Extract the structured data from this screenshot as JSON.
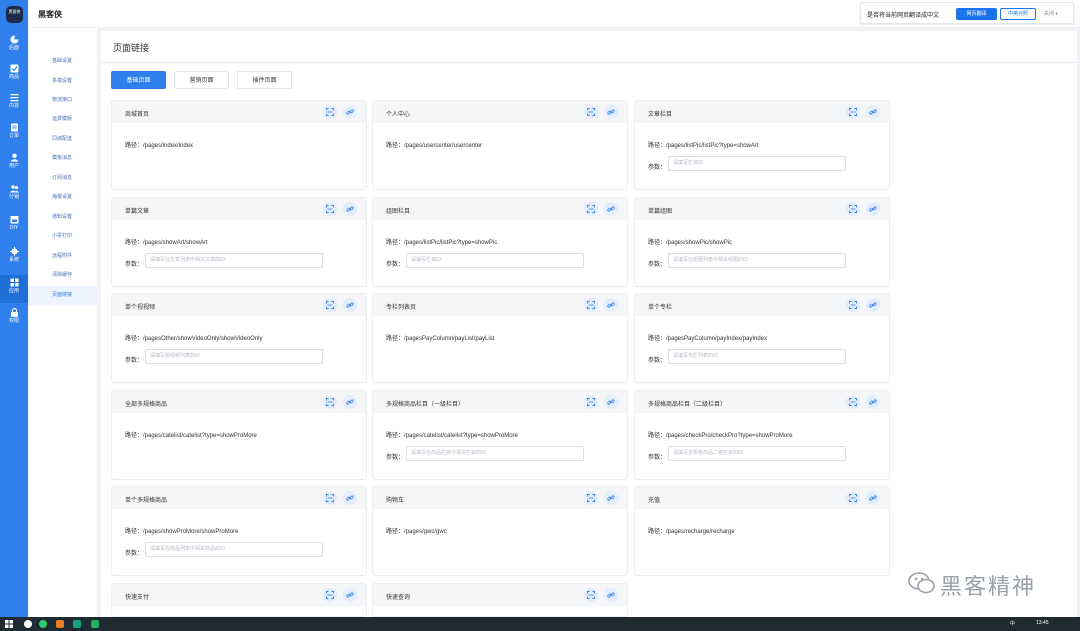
{
  "app": {
    "logo_text": "黑客侠",
    "brand": "黑客侠"
  },
  "rail": [
    {
      "label": "后面",
      "icon": "pie-icon"
    },
    {
      "label": "商品",
      "icon": "check-square-icon"
    },
    {
      "label": "内容",
      "icon": "list-icon"
    },
    {
      "label": "订单",
      "icon": "document-icon"
    },
    {
      "label": "用户",
      "icon": "user-icon"
    },
    {
      "label": "分销",
      "icon": "users-icon"
    },
    {
      "label": "DIY",
      "icon": "calendar-icon"
    },
    {
      "label": "系统",
      "icon": "gear-icon"
    },
    {
      "label": "应用",
      "icon": "grid-icon"
    },
    {
      "label": "权限",
      "icon": "lock-icon"
    }
  ],
  "subbar": [
    {
      "label": "基础设置"
    },
    {
      "label": "多端设置"
    },
    {
      "label": "物流接口"
    },
    {
      "label": "运费模版"
    },
    {
      "label": "同城配送"
    },
    {
      "label": "模板消息"
    },
    {
      "label": "订阅消息"
    },
    {
      "label": "海报设置"
    },
    {
      "label": "通知设置"
    },
    {
      "label": "小票打印"
    },
    {
      "label": "远程附件"
    },
    {
      "label": "清除缓存"
    },
    {
      "label": "页面链接"
    }
  ],
  "translate": {
    "question": "是否将当前网页翻译成中文",
    "translate_btn": "网页翻译",
    "compare_btn": "中英对照",
    "close_btn": "关闭"
  },
  "page": {
    "title": "页面链接",
    "tabs": [
      "基础页面",
      "营销页面",
      "插件页面"
    ]
  },
  "cards": [
    {
      "title": "商城首页",
      "path": "路径：/pages/index/index"
    },
    {
      "title": "个人中心",
      "path": "路径：/pages/usercenter/usercenter"
    },
    {
      "title": "文章栏目",
      "path": "路径：/pages/listPic/listPic?type=showArt",
      "param_label": "参数：",
      "param_placeholder": "请填写栏目ID"
    },
    {
      "title": "单篇文章",
      "path": "路径：/pages/showArt/showArt",
      "param_label": "参数：",
      "param_placeholder": "请填写在文章列表中相关文章的ID"
    },
    {
      "title": "组图栏目",
      "path": "路径：/pages/listPic/listPic?type=showPic",
      "param_label": "参数：",
      "param_placeholder": "请填写栏目ID"
    },
    {
      "title": "单篇组图",
      "path": "路径：/pages/showPic/showPic",
      "param_label": "参数：",
      "param_placeholder": "请填写在组图列表中相关组图的ID"
    },
    {
      "title": "单个视视频",
      "path": "路径：/pagesOther/showVideoOnly/showVideoOnly",
      "param_label": "参数：",
      "param_placeholder": "请填写视视频列表的ID"
    },
    {
      "title": "专栏列表页",
      "path": "路径：/pagesPayColumn/payList/payList"
    },
    {
      "title": "单个专栏",
      "path": "路径：/pagesPayColumn/payIndex/payIndex",
      "param_label": "参数：",
      "param_placeholder": "请填写专栏列表的ID"
    },
    {
      "title": "全部多规格商品",
      "path": "路径：/pages/catelist/catelist?type=showProMore"
    },
    {
      "title": "多规格商品栏目（一级栏目）",
      "path": "路径：/pages/catelist/catelist?type=showProMore",
      "param_label": "参数：",
      "param_placeholder": "请填写在商品栏目中相关栏目的ID"
    },
    {
      "title": "多规格商品栏目（二级栏目）",
      "path": "路径：/pages/checkPro/checkPro?type=showProMore",
      "param_label": "参数：",
      "param_placeholder": "请填写多规格商品二级栏目的ID"
    },
    {
      "title": "单个多规格商品",
      "path": "路径：/pages/showProMore/showProMore",
      "param_label": "参数：",
      "param_placeholder": "请填写在商品列表中相关商品的ID"
    },
    {
      "title": "购物车",
      "path": "路径：/pages/gwc/gwc"
    },
    {
      "title": "充值",
      "path": "路径：/pages/recharge/recharge"
    },
    {
      "title": "快速支付"
    },
    {
      "title": "快速查询"
    }
  ],
  "watermark": "黑客精神",
  "taskbar": {
    "time": "13:45",
    "ime": "中"
  }
}
